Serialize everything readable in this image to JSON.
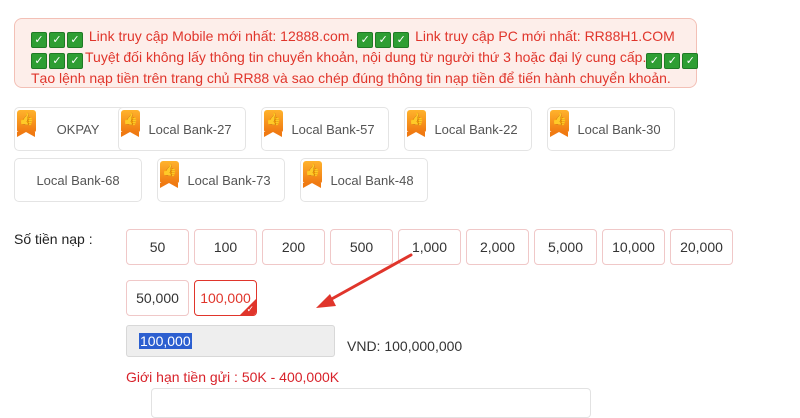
{
  "notice": {
    "line1_a": "Link truy cập Mobile mới nhất: 12888.com.",
    "line1_b": "Link truy cập PC mới nhất: RR88H1.COM",
    "line2": "Tuyệt đối không lấy thông tin chuyển khoản, nội dung từ người thứ 3 hoặc đại lý cung cấp.",
    "line3": "Tạo lệnh nạp tiền trên trang chủ RR88 và sao chép đúng thông tin nạp tiền để tiến hành chuyển khoản.",
    "check_glyph": "✓",
    "color": "#e0352b"
  },
  "methods": [
    {
      "label": "OKPAY",
      "badge": true,
      "selected": true
    },
    {
      "label": "Local Bank-27",
      "badge": true,
      "selected": false
    },
    {
      "label": "Local Bank-57",
      "badge": true,
      "selected": false
    },
    {
      "label": "Local Bank-22",
      "badge": true,
      "selected": false
    },
    {
      "label": "Local Bank-30",
      "badge": true,
      "selected": false
    },
    {
      "label": "Local Bank-68",
      "badge": false,
      "selected": false
    },
    {
      "label": "Local Bank-73",
      "badge": true,
      "selected": false
    },
    {
      "label": "Local Bank-48",
      "badge": true,
      "selected": false
    }
  ],
  "badge_icon": "thumbs-up-icon",
  "badge_glyph": "👍",
  "amount": {
    "label": "Số tiền nạp :",
    "options": [
      "50",
      "100",
      "200",
      "500",
      "1,000",
      "2,000",
      "5,000",
      "10,000",
      "20,000",
      "50,000",
      "100,000"
    ],
    "selected": "100,000",
    "input_value": "100,000",
    "vnd_text": "VND: 100,000,000",
    "limit_text": "Giới hạn tiền gửi :  50K - 400,000K"
  },
  "accent_color": "#e0352b"
}
